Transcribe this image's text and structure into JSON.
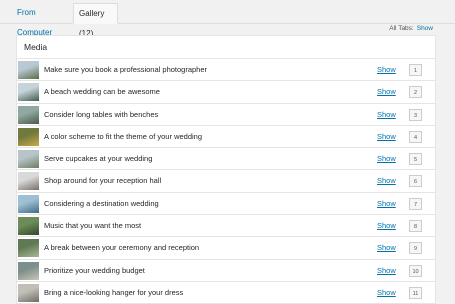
{
  "tabs": [
    {
      "label": "From Computer",
      "active": false
    },
    {
      "label": "Gallery (12)",
      "active": true
    }
  ],
  "all_tabs": {
    "label": "All Tabs:",
    "link": "Show"
  },
  "panel": {
    "title": "Media"
  },
  "colors": {
    "link": "#0073aa",
    "text": "#23282d",
    "border": "#e5e5e5"
  },
  "items": [
    {
      "title": "Make sure you book a professional photographer",
      "action": "Show",
      "order": "1",
      "thumb_colors": [
        "#b9c8d2",
        "#5b6c4a"
      ]
    },
    {
      "title": "A beach wedding can be awesome",
      "action": "Show",
      "order": "2",
      "thumb_colors": [
        "#c7d3db",
        "#3f5b4c"
      ]
    },
    {
      "title": "Consider long tables with benches",
      "action": "Show",
      "order": "3",
      "thumb_colors": [
        "#8fa8a2",
        "#4a5a48"
      ]
    },
    {
      "title": "A color scheme to fit the theme of your wedding",
      "action": "Show",
      "order": "4",
      "thumb_colors": [
        "#6f7a3c",
        "#caa94a"
      ]
    },
    {
      "title": "Serve cupcakes at your wedding",
      "action": "Show",
      "order": "5",
      "thumb_colors": [
        "#b7c4c9",
        "#6b7f61"
      ]
    },
    {
      "title": "Shop around for your reception hall",
      "action": "Show",
      "order": "6",
      "thumb_colors": [
        "#d9d9d9",
        "#7a6e66"
      ]
    },
    {
      "title": "Considering a destination wedding",
      "action": "Show",
      "order": "7",
      "thumb_colors": [
        "#9fc0d4",
        "#3e6a86"
      ]
    },
    {
      "title": "Music that you want the most",
      "action": "Show",
      "order": "8",
      "thumb_colors": [
        "#6d8c5a",
        "#2f4a2c"
      ]
    },
    {
      "title": "A break between your ceremony and reception",
      "action": "Show",
      "order": "9",
      "thumb_colors": [
        "#5f7a52",
        "#a8b79a"
      ]
    },
    {
      "title": "Prioritize your wedding budget",
      "action": "Show",
      "order": "10",
      "thumb_colors": [
        "#7d8f8a",
        "#c9c4b8"
      ]
    },
    {
      "title": "Bring a nice-looking hanger for your dress",
      "action": "Show",
      "order": "11",
      "thumb_colors": [
        "#c2bfb8",
        "#6e6a64"
      ]
    }
  ]
}
